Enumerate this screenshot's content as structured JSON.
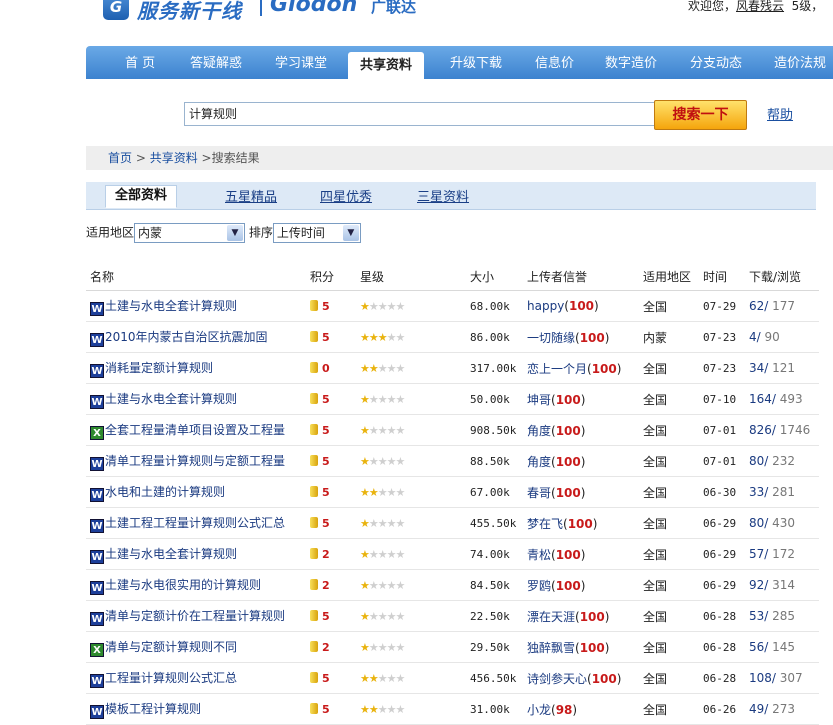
{
  "header": {
    "logo_mark": "G",
    "logo_cn": "服务新干线",
    "logo_en": "Glodon",
    "logo_cn2": "广联达",
    "welcome": "欢迎您，",
    "username": "风春残云",
    "level": "5级，"
  },
  "nav": {
    "items": [
      {
        "label": "首 页"
      },
      {
        "label": "答疑解惑"
      },
      {
        "label": "学习课堂"
      },
      {
        "label": "共享资料",
        "active": true
      },
      {
        "label": "升级下载"
      },
      {
        "label": "信息价"
      },
      {
        "label": "数字造价"
      },
      {
        "label": "分支动态"
      },
      {
        "label": "造价法规"
      }
    ]
  },
  "search": {
    "value": "计算规则",
    "button_label": "搜索一下",
    "help_label": "帮助"
  },
  "breadcrumb": {
    "home": "首页",
    "sep": " > ",
    "section": "共享资料",
    "current": " >搜索结果"
  },
  "tabs": [
    {
      "label": "全部资料",
      "active": true
    },
    {
      "label": "五星精品"
    },
    {
      "label": "四星优秀"
    },
    {
      "label": "三星资料"
    }
  ],
  "filters": {
    "region_label": "适用地区",
    "region_value": "内蒙",
    "sort_label": "排序",
    "sort_value": "上传时间"
  },
  "table": {
    "headers": {
      "name": "名称",
      "points": "积分",
      "rating": "星级",
      "size": "大小",
      "uploader": "上传者信誉",
      "region": "适用地区",
      "time": "时间",
      "downloads": "下载/浏览"
    },
    "rows": [
      {
        "type": "word",
        "name": "土建与水电全套计算规则",
        "points": "5",
        "stars": 1,
        "size": "68.00k",
        "uploader": "happy",
        "rep": "100",
        "region": "全国",
        "time": "07-29",
        "downloads": "62/",
        "views": " 177"
      },
      {
        "type": "word",
        "name": "2010年内蒙古自治区抗震加固",
        "points": "5",
        "stars": 3,
        "size": "86.00k",
        "uploader": "一切随缘",
        "rep": "100",
        "region": "内蒙",
        "time": "07-23",
        "downloads": "4/",
        "views": " 90"
      },
      {
        "type": "word",
        "name": "消耗量定额计算规则",
        "points": "0",
        "stars": 2,
        "size": "317.00k",
        "uploader": "恋上一个月",
        "rep": "100",
        "region": "全国",
        "time": "07-23",
        "downloads": "34/",
        "views": " 121"
      },
      {
        "type": "word",
        "name": "土建与水电全套计算规则",
        "points": "5",
        "stars": 1,
        "size": "50.00k",
        "uploader": "坤哥",
        "rep": "100",
        "region": "全国",
        "time": "07-10",
        "downloads": "164/",
        "views": " 493"
      },
      {
        "type": "excel",
        "name": "全套工程量清单项目设置及工程量",
        "points": "5",
        "stars": 1,
        "size": "908.50k",
        "uploader": "角度",
        "rep": "100",
        "region": "全国",
        "time": "07-01",
        "downloads": "826/",
        "views": " 1746"
      },
      {
        "type": "word",
        "name": "清单工程量计算规则与定额工程量",
        "points": "5",
        "stars": 1,
        "size": "88.50k",
        "uploader": "角度",
        "rep": "100",
        "region": "全国",
        "time": "07-01",
        "downloads": "80/",
        "views": " 232"
      },
      {
        "type": "word",
        "name": "水电和土建的计算规则",
        "points": "5",
        "stars": 2,
        "size": "67.00k",
        "uploader": "春哥",
        "rep": "100",
        "region": "全国",
        "time": "06-30",
        "downloads": "33/",
        "views": " 281"
      },
      {
        "type": "word",
        "name": "土建工程工程量计算规则公式汇总",
        "points": "5",
        "stars": 1,
        "size": "455.50k",
        "uploader": "梦在飞",
        "rep": "100",
        "region": "全国",
        "time": "06-29",
        "downloads": "80/",
        "views": " 430"
      },
      {
        "type": "word",
        "name": "土建与水电全套计算规则",
        "points": "2",
        "stars": 1,
        "size": "74.00k",
        "uploader": "青松",
        "rep": "100",
        "region": "全国",
        "time": "06-29",
        "downloads": "57/",
        "views": " 172"
      },
      {
        "type": "word",
        "name": "土建与水电很实用的计算规则",
        "points": "2",
        "stars": 1,
        "size": "84.50k",
        "uploader": "罗鸥",
        "rep": "100",
        "region": "全国",
        "time": "06-29",
        "downloads": "92/",
        "views": " 314"
      },
      {
        "type": "word",
        "name": "清单与定额计价在工程量计算规则",
        "points": "5",
        "stars": 1,
        "size": "22.50k",
        "uploader": "漂在天涯",
        "rep": "100",
        "region": "全国",
        "time": "06-28",
        "downloads": "53/",
        "views": " 285"
      },
      {
        "type": "excel",
        "name": "清单与定额计算规则不同",
        "points": "2",
        "stars": 1,
        "size": "29.50k",
        "uploader": "独醉飘雪",
        "rep": "100",
        "region": "全国",
        "time": "06-28",
        "downloads": "56/",
        "views": " 145"
      },
      {
        "type": "word",
        "name": "工程量计算规则公式汇总",
        "points": "5",
        "stars": 2,
        "size": "456.50k",
        "uploader": "诗剑参天心",
        "rep": "100",
        "region": "全国",
        "time": "06-28",
        "downloads": "108/",
        "views": " 307"
      },
      {
        "type": "word",
        "name": "模板工程计算规则",
        "points": "5",
        "stars": 2,
        "size": "31.00k",
        "uploader": "小龙",
        "rep": "98",
        "region": "全国",
        "time": "06-26",
        "downloads": "49/",
        "views": " 273"
      }
    ]
  }
}
